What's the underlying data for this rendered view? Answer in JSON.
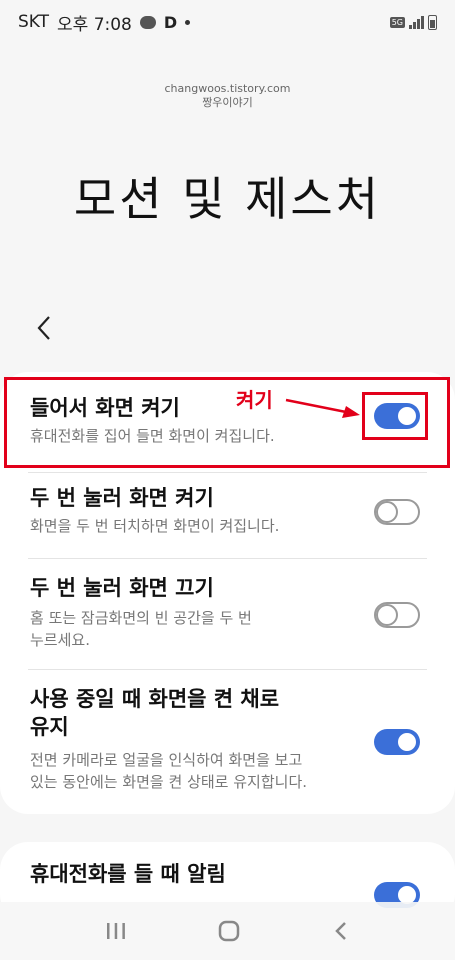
{
  "status_bar": {
    "carrier": "SKT",
    "time": "오후 7:08",
    "app_letter": "D",
    "network": "5G"
  },
  "watermark": {
    "line1": "changwoos.tistory.com",
    "line2": "짱우이야기"
  },
  "page": {
    "title": "모션 및 제스처"
  },
  "settings": [
    {
      "title": "들어서 화면 켜기",
      "description": "휴대전화를 집어 들면 화면이 켜집니다.",
      "enabled": true
    },
    {
      "title": "두 번 눌러 화면 켜기",
      "description": "화면을 두 번 터치하면 화면이 켜집니다.",
      "enabled": false
    },
    {
      "title": "두 번 눌러 화면 끄기",
      "description_line1": "홈 또는 잠금화면의 빈 공간을 두 번",
      "description_line2": "누르세요.",
      "enabled": false
    },
    {
      "title_line1": "사용 중일 때 화면을 켠 채로",
      "title_line2": "유지",
      "description_line1": "전면 카메라로 얼굴을 인식하여 화면을 보고",
      "description_line2": "있는 동안에는 화면을 켠 상태로 유지합니다.",
      "enabled": true
    },
    {
      "title": "휴대전화를 들 때 알림",
      "enabled": true
    }
  ],
  "annotation": {
    "label": "켜기"
  },
  "colors": {
    "toggle_on": "#3b6fd8",
    "annotation_red": "#e2001a"
  }
}
